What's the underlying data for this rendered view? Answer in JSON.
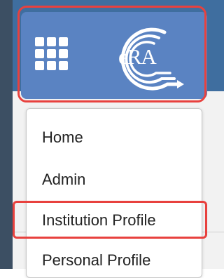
{
  "header": {
    "apps_icon": "grid-icon",
    "logo_text": "eRA"
  },
  "menu": {
    "items": [
      {
        "label": "Home"
      },
      {
        "label": "Admin"
      },
      {
        "label": "Institution Profile"
      },
      {
        "label": "Personal Profile"
      }
    ]
  },
  "colors": {
    "header_bg": "#3f6e9f",
    "app_bar": "#5a83c2",
    "highlight": "#e8413e",
    "menu_text": "#222222"
  }
}
